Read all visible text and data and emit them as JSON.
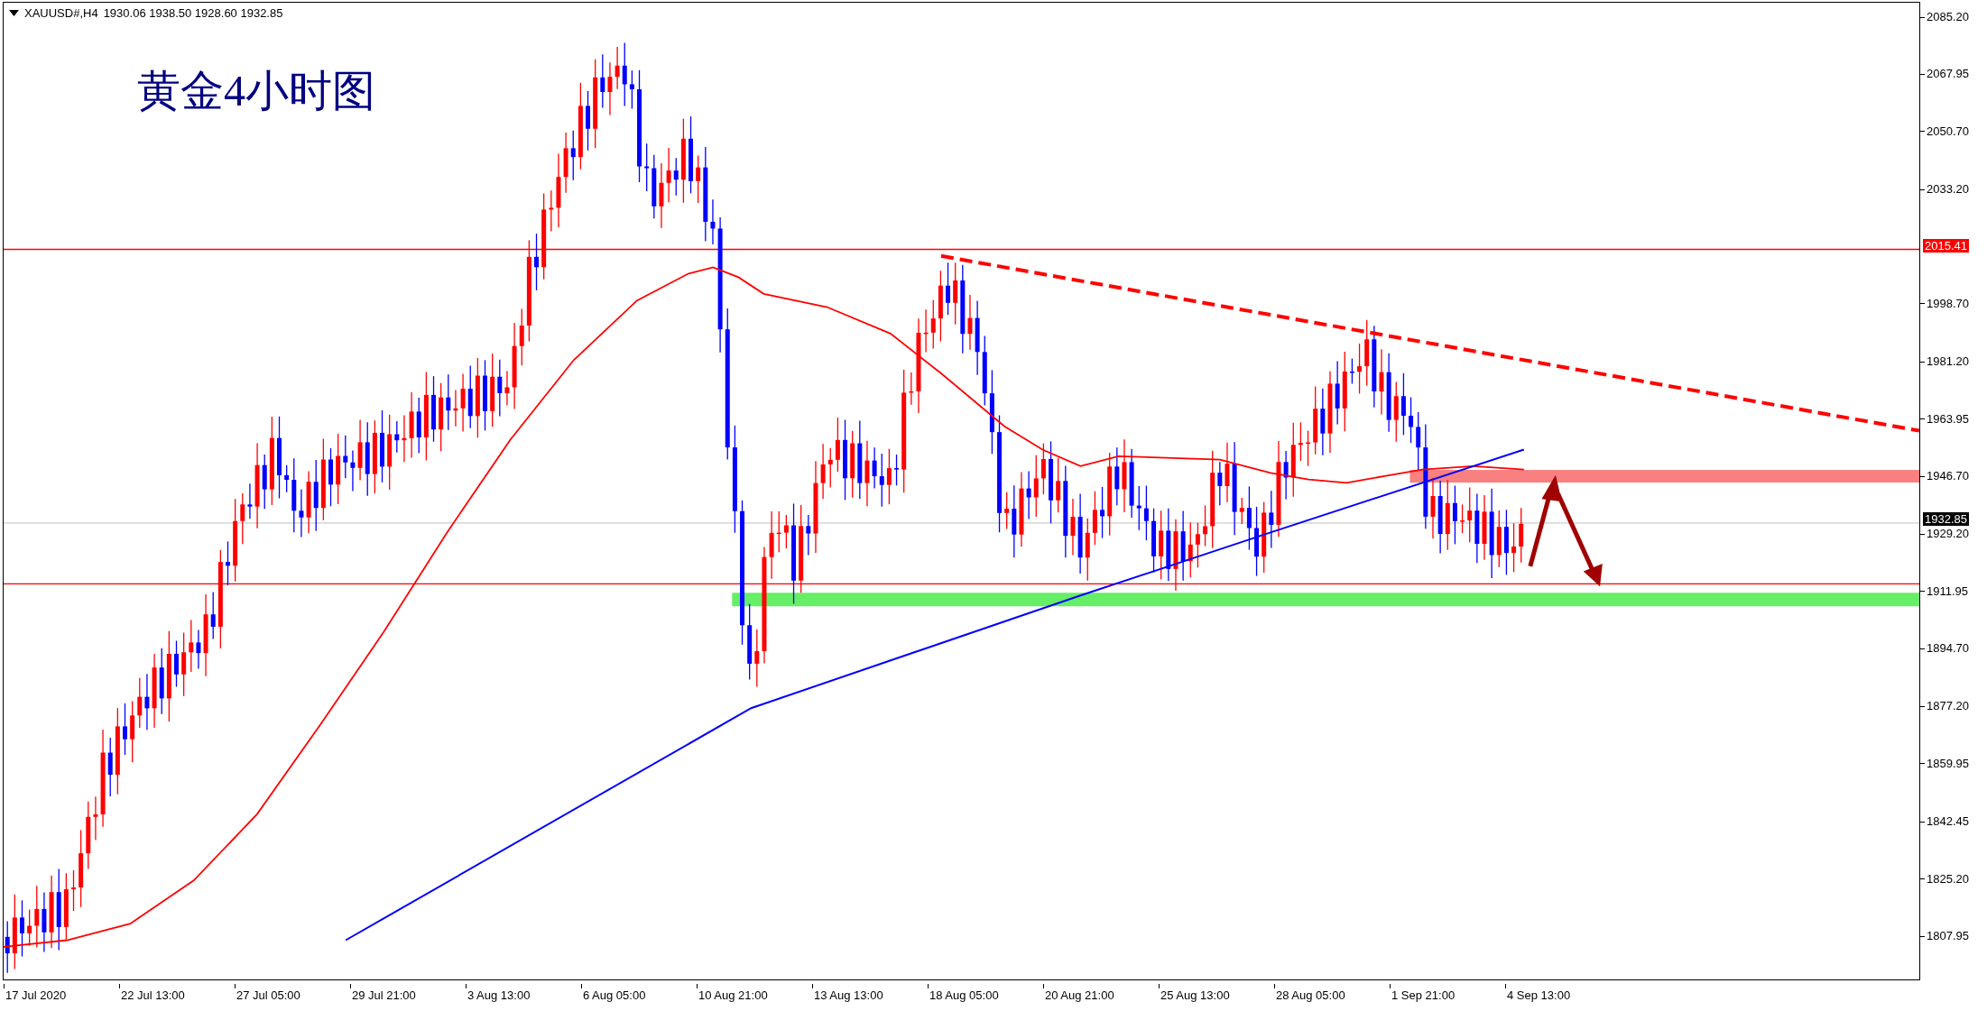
{
  "chart_header": {
    "symbol": "XAUUSD#,H4",
    "ohlc": "1930.06 1938.50 1928.60 1932.85"
  },
  "annotation": "黄金4小时图",
  "price_axis": [
    "2085.20",
    "2067.95",
    "2050.70",
    "2033.20",
    "1998.70",
    "1981.20",
    "1963.95",
    "1946.70",
    "1929.20",
    "1911.95",
    "1894.70",
    "1877.20",
    "1859.95",
    "1842.45",
    "1825.20",
    "1807.95"
  ],
  "price_tags": [
    {
      "kind": "line",
      "label": "2015.41"
    },
    {
      "kind": "bid",
      "label": "1932.85"
    }
  ],
  "time_axis": [
    "17 Jul 2020",
    "22 Jul 13:00",
    "27 Jul 05:00",
    "29 Jul 21:00",
    "3 Aug 13:00",
    "6 Aug 05:00",
    "10 Aug 21:00",
    "13 Aug 13:00",
    "18 Aug 05:00",
    "20 Aug 21:00",
    "25 Aug 13:00",
    "28 Aug 05:00",
    "1 Sep 21:00",
    "4 Sep 13:00"
  ]
}
